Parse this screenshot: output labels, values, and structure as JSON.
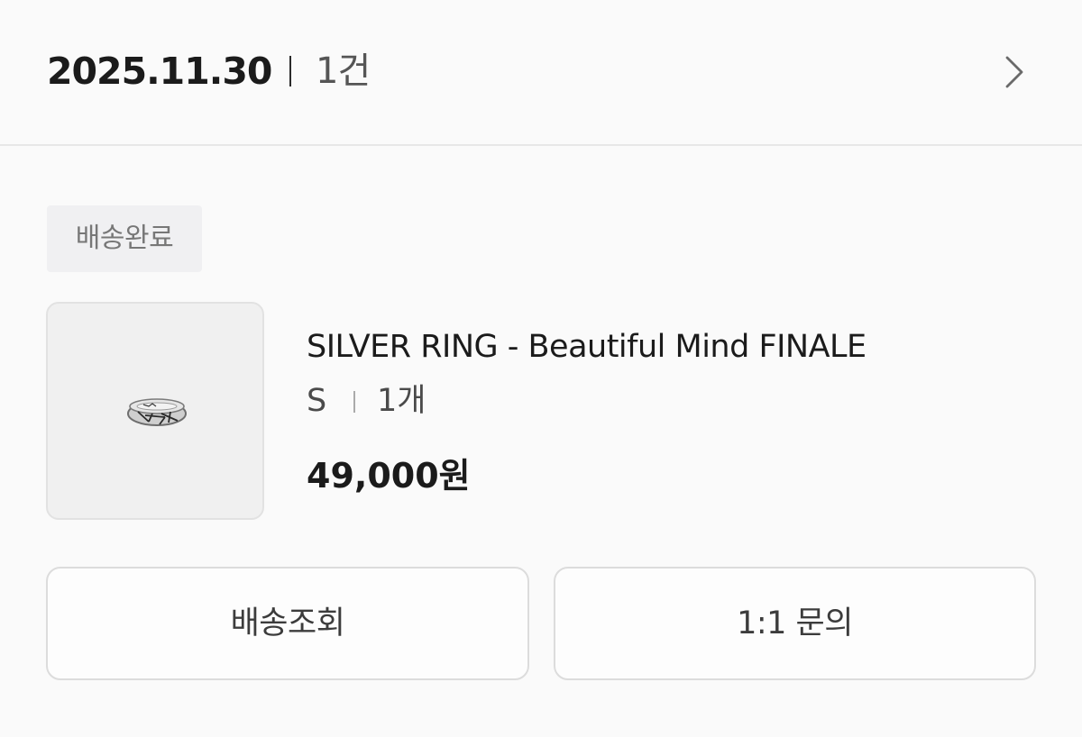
{
  "order": {
    "date": "2025.11.30",
    "count": "1건",
    "detail_icon": "chevron-right-icon"
  },
  "status": {
    "label": "배송완료"
  },
  "product": {
    "image_icon": "silver-ring-icon",
    "name": "SILVER RING - Beautiful Mind FINALE",
    "option": "S",
    "quantity": "1개",
    "price": "49,000원"
  },
  "actions": {
    "track_label": "배송조회",
    "inquiry_label": "1:1 문의"
  },
  "colors": {
    "background": "#fafafa",
    "text": "#1b1b1b",
    "badge_bg": "#f0f0f2",
    "border": "#dcdcdc"
  }
}
